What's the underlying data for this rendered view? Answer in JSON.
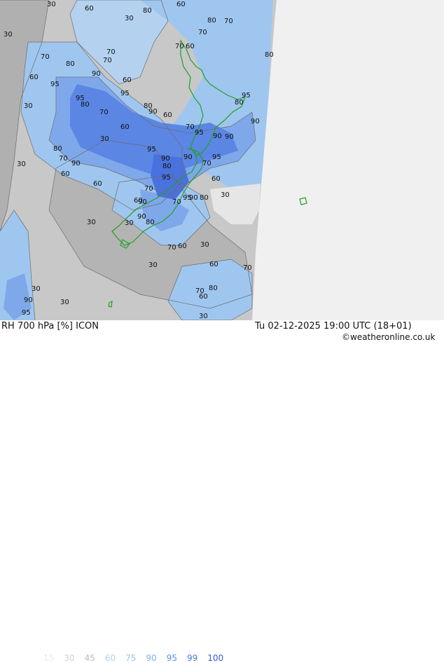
{
  "product": {
    "label": "RH 700 hPa [%] ICON",
    "valid_time": "Tu 02-12-2025 19:00 UTC (18+01)",
    "credit": "©weatheronline.co.uk"
  },
  "legend": {
    "values": [
      "15",
      "30",
      "45",
      "60",
      "75",
      "90",
      "95",
      "99",
      "100"
    ],
    "colors": [
      "#e8e8e8",
      "#d2d2d2",
      "#bdbdbd",
      "#b4d2f0",
      "#96c3ee",
      "#7fb1ea",
      "#5c8fe6",
      "#4a74e0",
      "#3a5ad8"
    ]
  },
  "map": {
    "nodata_color": "#f0f0f0",
    "coast_color": "#22a022",
    "contour_labels": [
      {
        "t": "30"
      },
      {
        "t": "60"
      },
      {
        "t": "30"
      },
      {
        "t": "80"
      },
      {
        "t": "60"
      },
      {
        "t": "30"
      },
      {
        "t": "80"
      },
      {
        "t": "70"
      },
      {
        "t": "70"
      },
      {
        "t": "70"
      },
      {
        "t": "60"
      },
      {
        "t": "70"
      },
      {
        "t": "70"
      },
      {
        "t": "80"
      },
      {
        "t": "70"
      },
      {
        "t": "80"
      },
      {
        "t": "90"
      },
      {
        "t": "60"
      },
      {
        "t": "95"
      },
      {
        "t": "60"
      },
      {
        "t": "95"
      },
      {
        "t": "80"
      },
      {
        "t": "95"
      },
      {
        "t": "30"
      },
      {
        "t": "80"
      },
      {
        "t": "70"
      },
      {
        "t": "90"
      },
      {
        "t": "60"
      },
      {
        "t": "95"
      },
      {
        "t": "80"
      },
      {
        "t": "90"
      },
      {
        "t": "60"
      },
      {
        "t": "70"
      },
      {
        "t": "95"
      },
      {
        "t": "90"
      },
      {
        "t": "30"
      },
      {
        "t": "80"
      },
      {
        "t": "95"
      },
      {
        "t": "90"
      },
      {
        "t": "90"
      },
      {
        "t": "95"
      },
      {
        "t": "90"
      },
      {
        "t": "70"
      },
      {
        "t": "30"
      },
      {
        "t": "80"
      },
      {
        "t": "70"
      },
      {
        "t": "90"
      },
      {
        "t": "60"
      },
      {
        "t": "95"
      },
      {
        "t": "60"
      },
      {
        "t": "70"
      },
      {
        "t": "30"
      },
      {
        "t": "60"
      },
      {
        "t": "95"
      },
      {
        "t": "90"
      },
      {
        "t": "80"
      },
      {
        "t": "70"
      },
      {
        "t": "90"
      },
      {
        "t": "30"
      },
      {
        "t": "60"
      },
      {
        "t": "90"
      },
      {
        "t": "30"
      },
      {
        "t": "80"
      },
      {
        "t": "70"
      },
      {
        "t": "60"
      },
      {
        "t": "30"
      },
      {
        "t": "30"
      },
      {
        "t": "60"
      },
      {
        "t": "70"
      },
      {
        "t": "30"
      },
      {
        "t": "30"
      },
      {
        "t": "70"
      },
      {
        "t": "80"
      },
      {
        "t": "60"
      },
      {
        "t": "90"
      },
      {
        "t": "30"
      },
      {
        "t": "95"
      }
    ]
  }
}
